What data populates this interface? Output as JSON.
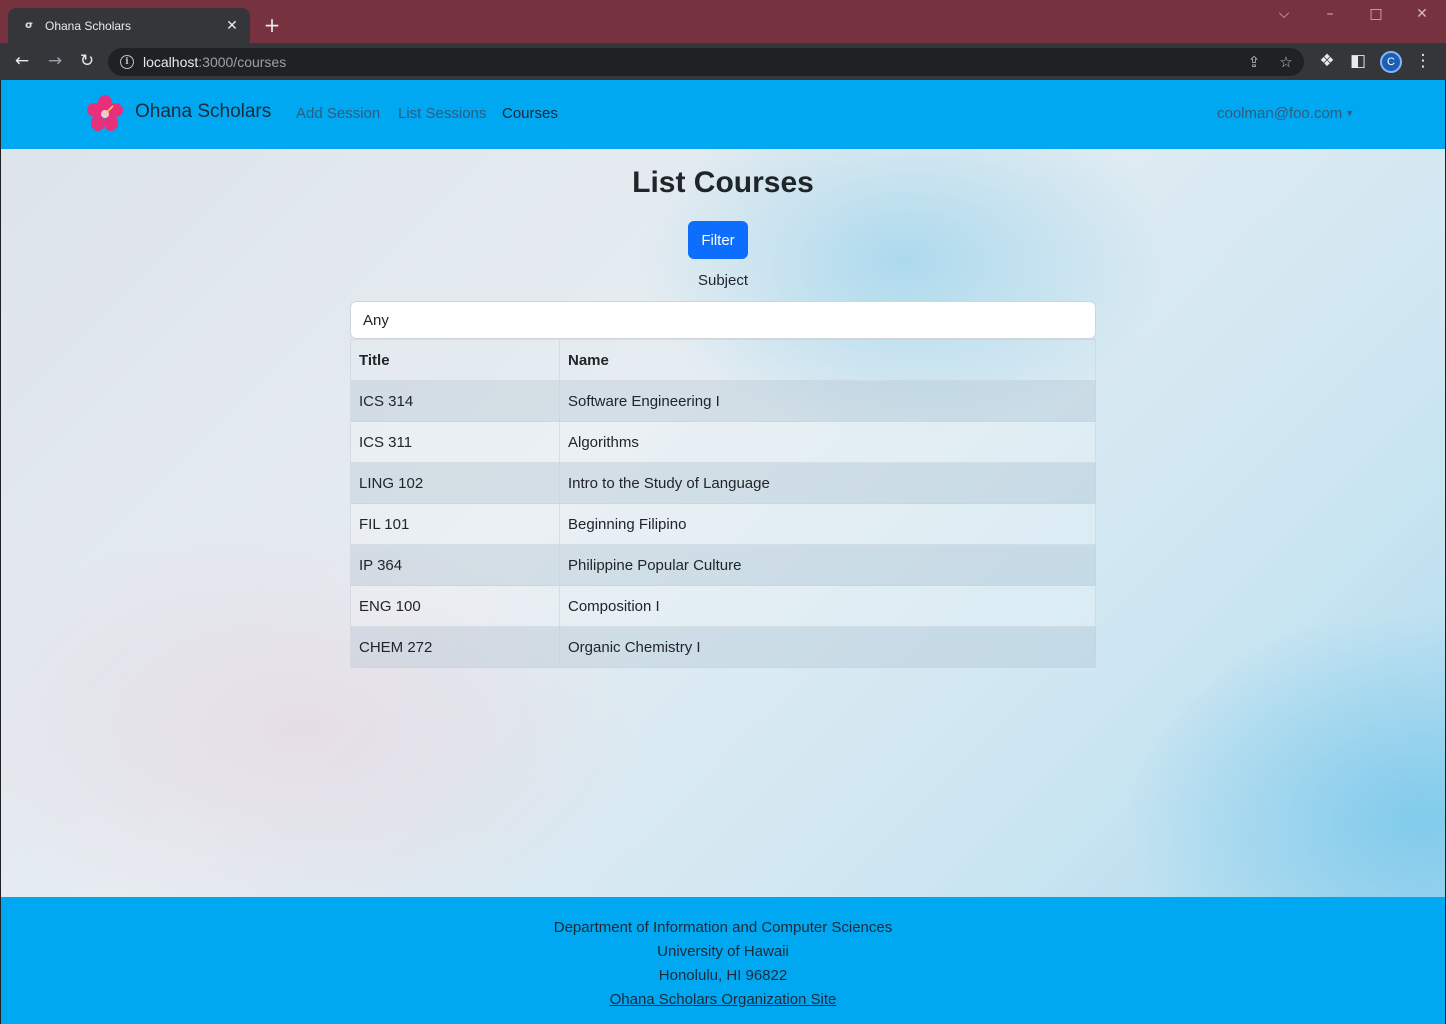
{
  "browser": {
    "tab_title": "Ohana Scholars",
    "url_host": "localhost",
    "url_path": ":3000/courses",
    "profile_initial": "C"
  },
  "navbar": {
    "brand": "Ohana Scholars",
    "links": [
      "Add Session",
      "List Sessions",
      "Courses"
    ],
    "active_link": "Courses",
    "user": "coolman@foo.com"
  },
  "main": {
    "title": "List Courses",
    "filter_button": "Filter",
    "subject_label": "Subject",
    "subject_value": "Any",
    "table": {
      "headers": [
        "Title",
        "Name"
      ],
      "rows": [
        [
          "ICS 314",
          "Software Engineering I"
        ],
        [
          "ICS 311",
          "Algorithms"
        ],
        [
          "LING 102",
          "Intro to the Study of Language"
        ],
        [
          "FIL 101",
          "Beginning Filipino"
        ],
        [
          "IP 364",
          "Philippine Popular Culture"
        ],
        [
          "ENG 100",
          "Composition I"
        ],
        [
          "CHEM 272",
          "Organic Chemistry I"
        ]
      ]
    }
  },
  "footer": {
    "line1": "Department of Information and Computer Sciences",
    "line2": "University of Hawaii",
    "line3": "Honolulu, HI 96822",
    "link": "Ohana Scholars Organization Site"
  },
  "colors": {
    "navbar": "#00a7f1",
    "primary_button": "#0d6efd",
    "titlebar": "#76323f"
  }
}
